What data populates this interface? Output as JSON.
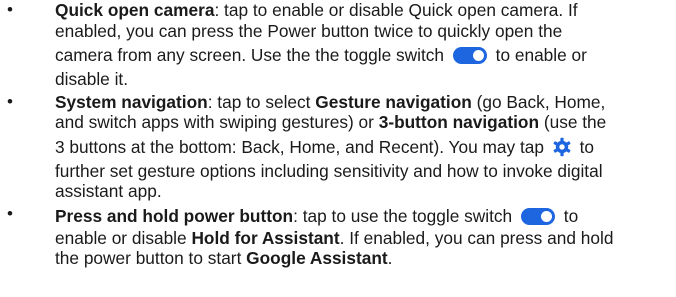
{
  "bullets": [
    "•",
    "•",
    "•"
  ],
  "items": [
    {
      "title": "Quick open camera",
      "l1_rest": ": tap to enable or disable Quick open camera. If",
      "l2": "enabled, you can press the Power button twice to quickly open the",
      "l3_a": "camera from any screen. Use the the toggle switch",
      "l3_b": "to enable or",
      "l4": "disable it."
    },
    {
      "title": "System navigation",
      "l1_a": ": tap to select ",
      "gesture": "Gesture navigation",
      "l1_b": " (go Back, Home,",
      "l2_a": "and switch apps with swiping gestures) or ",
      "three_button": "3-button navigation",
      "l2_b": " (use the",
      "l3_a": "3 buttons at the bottom: Back, Home, and Recent). You may tap",
      "l3_b": "to",
      "l4": "further set gesture options including sensitivity and how to invoke digital",
      "l5": "assistant app."
    },
    {
      "title": "Press and hold power button",
      "l1_a": ": tap to use the toggle switch",
      "l1_b": "to",
      "l2_a": "enable or disable ",
      "hold": "Hold for Assistant",
      "l2_b": ". If enabled, you can press and hold",
      "l3_a": "the power button to start ",
      "google": "Google Assistant",
      "l3_b": "."
    }
  ],
  "icons": {
    "toggle": "toggle-switch-on-icon",
    "gear": "gear-settings-icon",
    "accent": "#1e66e0"
  }
}
